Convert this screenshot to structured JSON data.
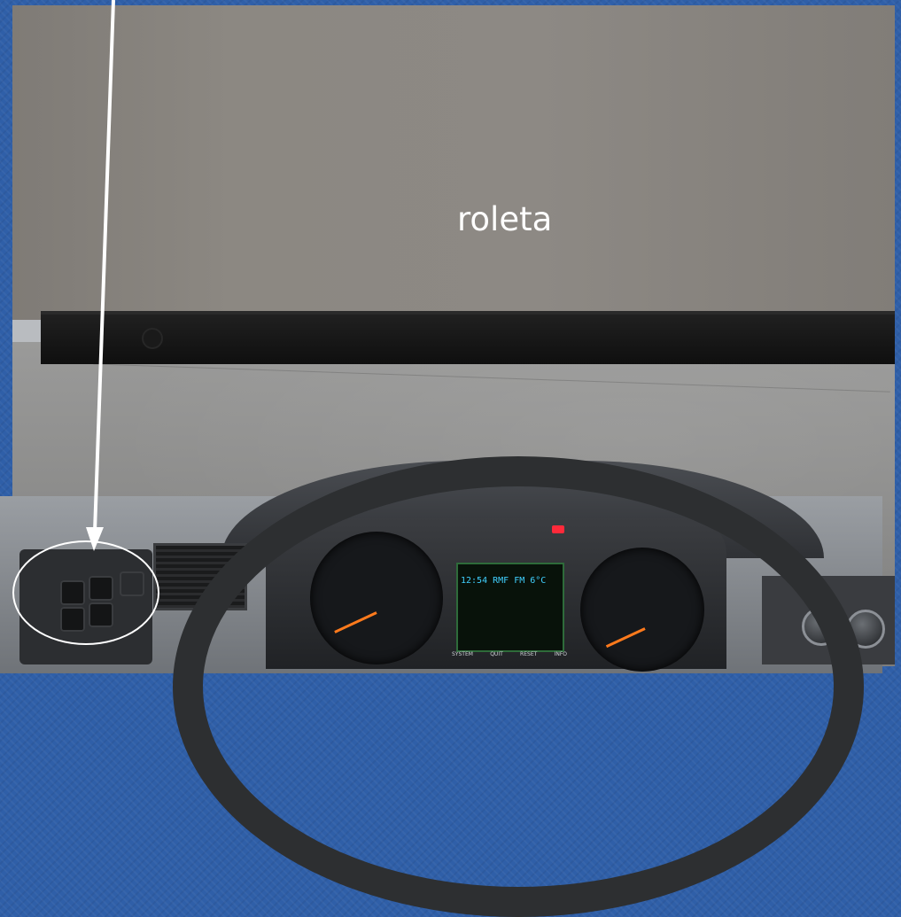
{
  "annotation": {
    "label": "roleta"
  },
  "instrument_cluster": {
    "lcd_line": "12:54  RMF FM   6°C",
    "buttons": [
      "SYSTEM",
      "QUIT",
      "RESET",
      "INFO"
    ]
  },
  "colors": {
    "slide_background": "#2f5fa8",
    "annotation_stroke": "#ffffff",
    "gauge_needle": "#ff7a1c",
    "warning_light": "#ff2a3a"
  }
}
